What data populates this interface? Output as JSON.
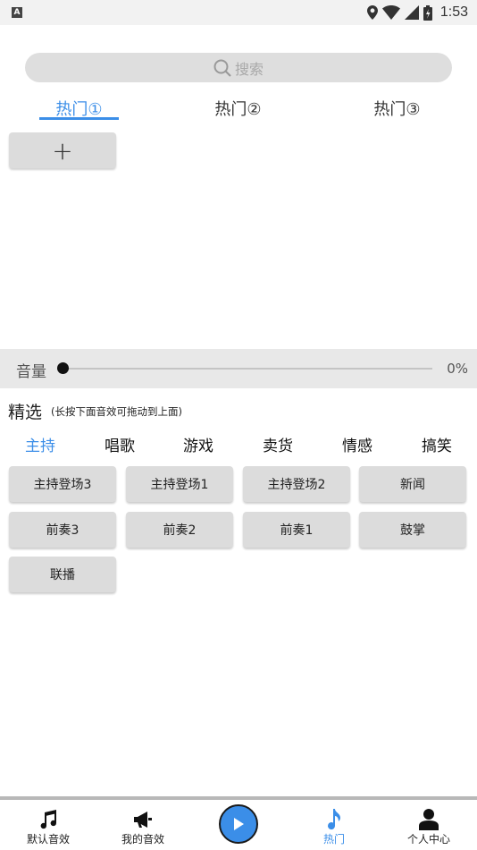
{
  "status_bar": {
    "app_badge": "A",
    "time": "1:53",
    "icons": [
      "location-icon",
      "wifi-icon",
      "signal-icon",
      "battery-icon"
    ]
  },
  "search": {
    "placeholder": "搜索",
    "icon": "search-icon"
  },
  "hot_tabs": [
    {
      "label": "热门①",
      "active": true
    },
    {
      "label": "热门②",
      "active": false
    },
    {
      "label": "热门③",
      "active": false
    }
  ],
  "add_button": {
    "label": "+"
  },
  "volume": {
    "label": "音量",
    "value_text": "0%",
    "value": 0
  },
  "featured": {
    "title": "精选",
    "hint": "(长按下面音效可拖动到上面)"
  },
  "category_tabs": [
    {
      "label": "主持",
      "active": true
    },
    {
      "label": "唱歌",
      "active": false
    },
    {
      "label": "游戏",
      "active": false
    },
    {
      "label": "卖货",
      "active": false
    },
    {
      "label": "情感",
      "active": false
    },
    {
      "label": "搞笑",
      "active": false
    }
  ],
  "sound_buttons": [
    "主持登场3",
    "主持登场1",
    "主持登场2",
    "新闻",
    "前奏3",
    "前奏2",
    "前奏1",
    "鼓掌",
    "联播"
  ],
  "bottom_nav": {
    "items": [
      {
        "label": "默认音效",
        "icon": "music-note-icon",
        "active": false
      },
      {
        "label": "我的音效",
        "icon": "megaphone-icon",
        "active": false
      },
      {
        "label": "热门",
        "icon": "single-note-icon",
        "active": true
      },
      {
        "label": "个人中心",
        "icon": "person-icon",
        "active": false
      }
    ],
    "play_icon": "play-icon"
  },
  "colors": {
    "accent": "#3b8ee8",
    "button_bg": "#dcdcdc",
    "search_bg": "#dedede"
  }
}
